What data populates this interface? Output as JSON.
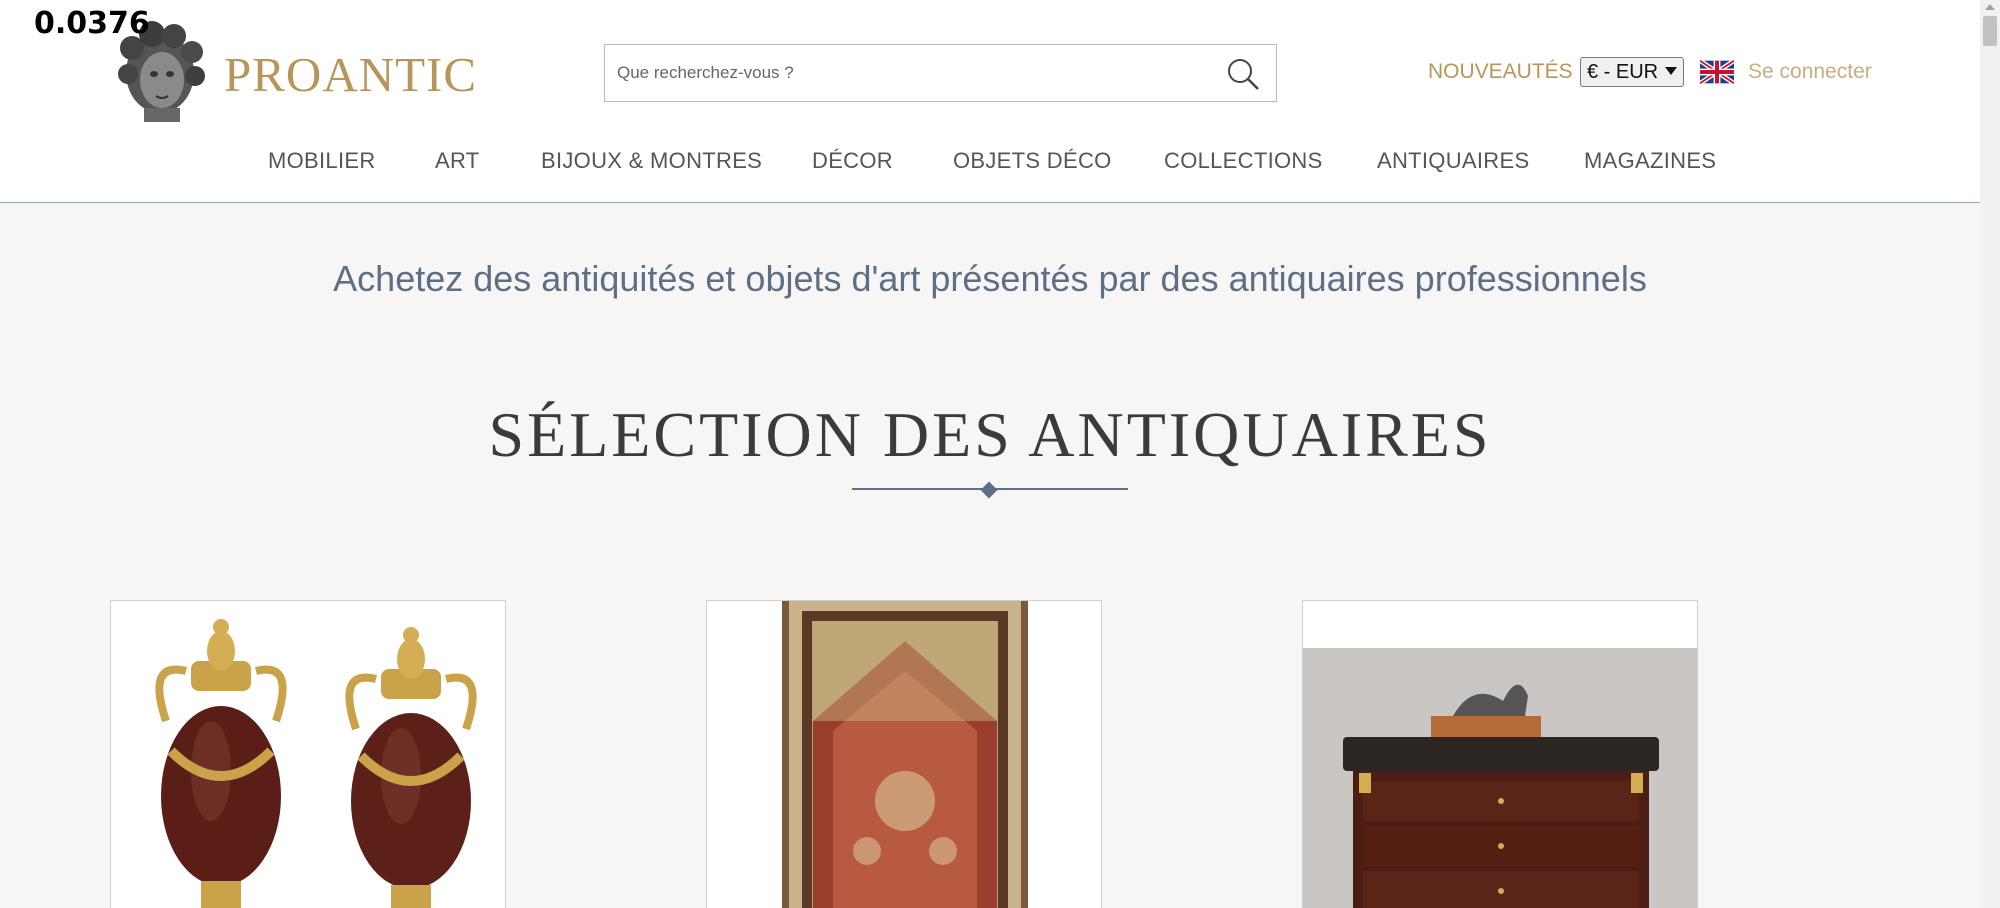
{
  "overlay": {
    "value": "0.0376"
  },
  "brand": {
    "name": "PROANTIC"
  },
  "search": {
    "placeholder": "Que recherchez-vous ?"
  },
  "header_links": {
    "new_label": "NOUVEAUTÉS",
    "currency_selected": "€ - EUR",
    "language_icon": "uk-flag-icon",
    "login_label": "Se connecter"
  },
  "nav": {
    "items": [
      "MOBILIER",
      "ART",
      "BIJOUX & MONTRES",
      "DÉCOR",
      "OBJETS DÉCO",
      "COLLECTIONS",
      "ANTIQUAIRES",
      "MAGAZINES"
    ]
  },
  "main": {
    "tagline": "Achetez des antiquités et objets d'art présentés par des antiquaires professionnels",
    "section_title": "SÉLECTION DES ANTIQUAIRES",
    "cards": [
      {
        "image_icon": "vases-image"
      },
      {
        "image_icon": "rug-image"
      },
      {
        "image_icon": "commode-image"
      }
    ]
  },
  "colors": {
    "gold": "#b8955a",
    "slate": "#5d6f86",
    "background": "#f7f6f4"
  }
}
